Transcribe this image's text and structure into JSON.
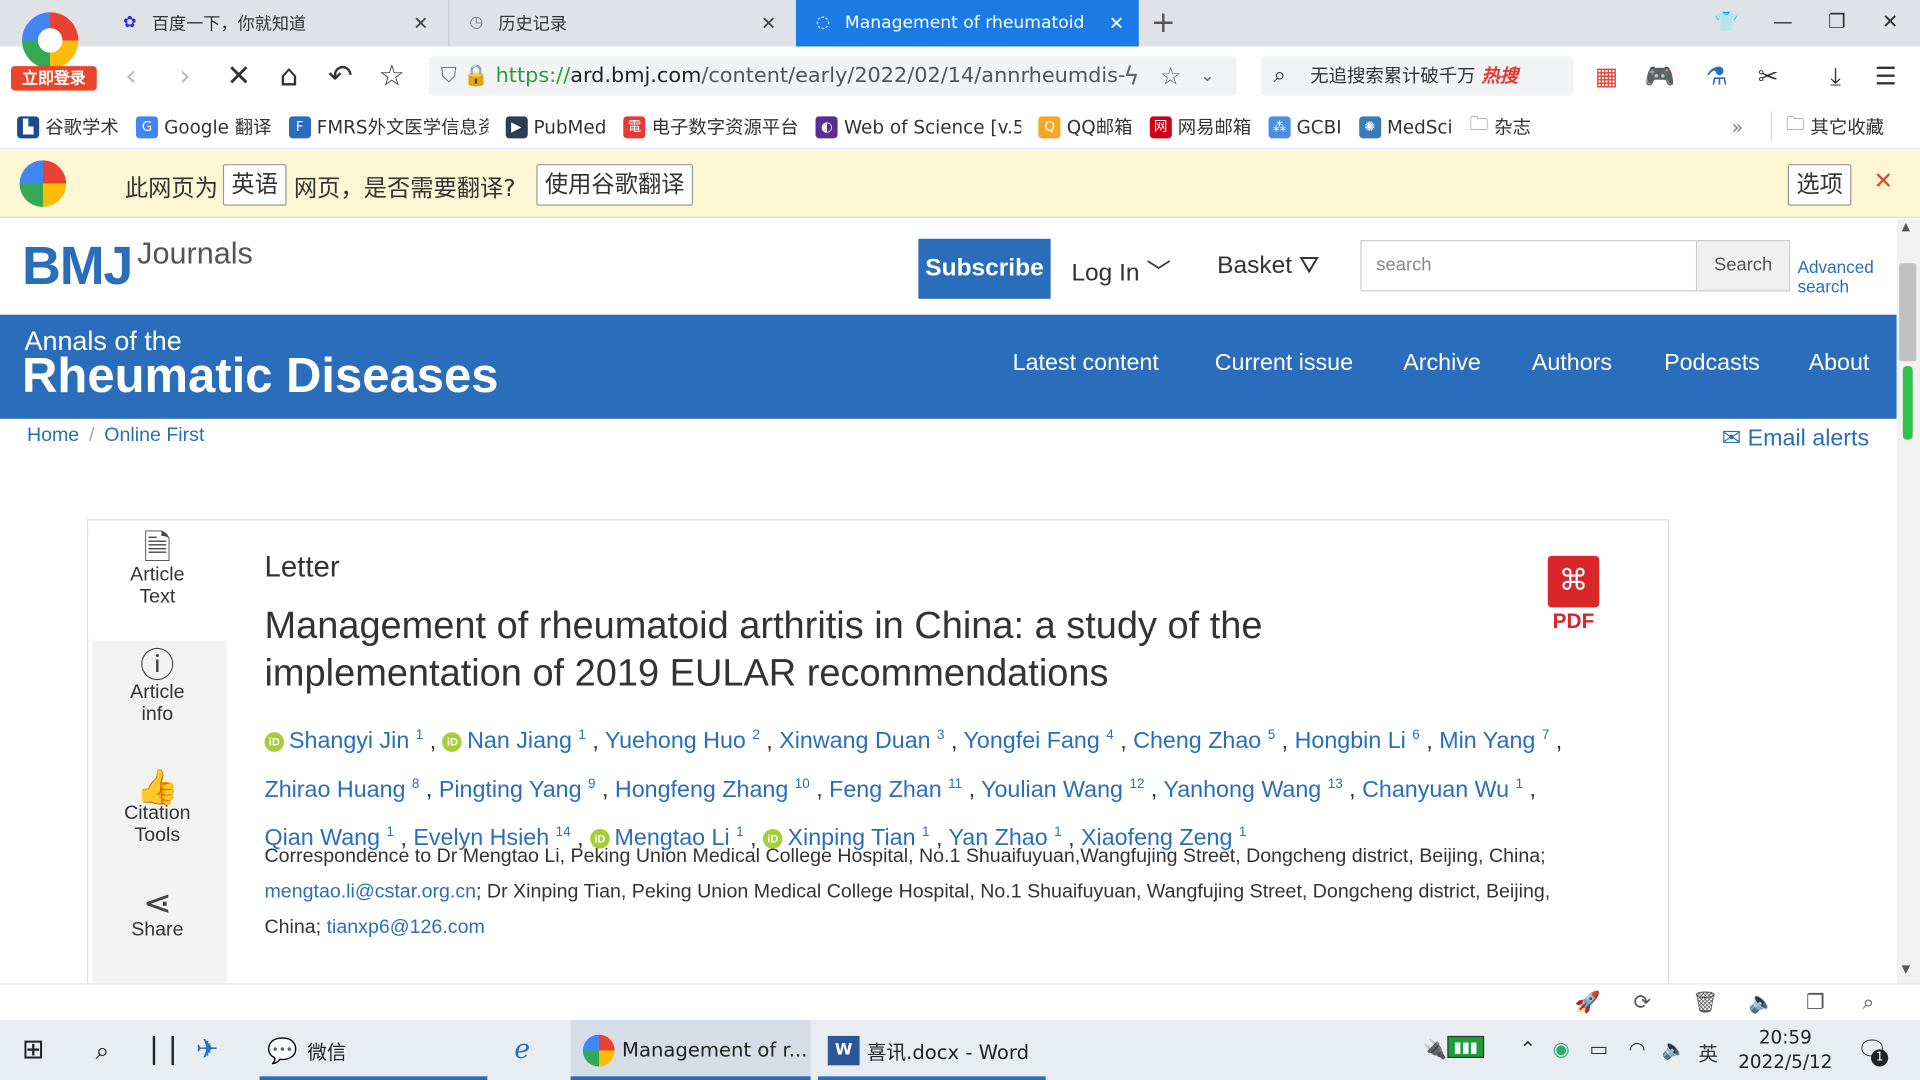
{
  "browser": {
    "login_badge": "立即登录",
    "tabs": [
      {
        "title": "百度一下，你就知道",
        "icon": "baidu-icon"
      },
      {
        "title": "历史记录",
        "icon": "history-icon"
      },
      {
        "title": "Management of rheumatoid",
        "icon": "loading-icon"
      }
    ],
    "url_scheme": "https://",
    "url_host": "ard.bmj.com",
    "url_path": "/content/early/2022/02/14/annrheumdis-",
    "search_hint": "无追搜索累计破千万",
    "search_hot": "热搜",
    "bookmarks": [
      "谷歌学术",
      "Google 翻译",
      "FMRS外文医学信息资",
      "PubMed",
      "电子数字资源平台",
      "Web of Science [v.5",
      "QQ邮箱",
      "网易邮箱",
      "GCBI",
      "MedSci",
      "杂志"
    ],
    "bookmarks_more": "»",
    "bookmarks_other": "其它收藏"
  },
  "translate": {
    "prefix": "此网页为",
    "language": "英语",
    "question": "网页，是否需要翻译?",
    "button": "使用谷歌翻译",
    "options": "选项",
    "close": "✕"
  },
  "site": {
    "logo": "BMJ",
    "journals": "Journals",
    "subscribe": "Subscribe",
    "login": "Log In",
    "basket": "Basket",
    "search_placeholder": "search",
    "search_button": "Search",
    "advanced_1": "Advanced",
    "advanced_2": "search",
    "journal_small": "Annals of the",
    "journal_big": "Rheumatic Diseases",
    "nav": [
      "Latest content",
      "Current issue",
      "Archive",
      "Authors",
      "Podcasts",
      "About"
    ],
    "breadcrumb_home": "Home",
    "breadcrumb_sep": "/",
    "breadcrumb_current": "Online First",
    "email_alerts": "Email alerts"
  },
  "sidebar": [
    {
      "label1": "Article",
      "label2": "Text"
    },
    {
      "label1": "Article",
      "label2": "info"
    },
    {
      "label1": "Citation",
      "label2": "Tools"
    },
    {
      "label1": "Share",
      "label2": ""
    }
  ],
  "article": {
    "type": "Letter",
    "title": "Management of rheumatoid arthritis in China: a study of the implementation of 2019 EULAR recommendations",
    "pdf_label": "PDF",
    "authors": [
      {
        "name": "Shangyi Jin",
        "sup": "1",
        "orcid": true
      },
      {
        "name": "Nan Jiang",
        "sup": "1",
        "orcid": true
      },
      {
        "name": "Yuehong Huo",
        "sup": "2",
        "orcid": false
      },
      {
        "name": "Xinwang Duan",
        "sup": "3",
        "orcid": false
      },
      {
        "name": "Yongfei Fang",
        "sup": "4",
        "orcid": false
      },
      {
        "name": "Cheng Zhao",
        "sup": "5",
        "orcid": false
      },
      {
        "name": "Hongbin Li",
        "sup": "6",
        "orcid": false
      },
      {
        "name": "Min Yang",
        "sup": "7",
        "orcid": false
      },
      {
        "name": "Zhirao Huang",
        "sup": "8",
        "orcid": false
      },
      {
        "name": "Pingting Yang",
        "sup": "9",
        "orcid": false
      },
      {
        "name": "Hongfeng Zhang",
        "sup": "10",
        "orcid": false
      },
      {
        "name": "Feng Zhan",
        "sup": "11",
        "orcid": false
      },
      {
        "name": "Youlian Wang",
        "sup": "12",
        "orcid": false
      },
      {
        "name": "Yanhong Wang",
        "sup": "13",
        "orcid": false
      },
      {
        "name": "Chanyuan Wu",
        "sup": "1",
        "orcid": false
      },
      {
        "name": "Qian Wang",
        "sup": "1",
        "orcid": false
      },
      {
        "name": "Evelyn Hsieh",
        "sup": "14",
        "orcid": false
      },
      {
        "name": "Mengtao Li",
        "sup": "1",
        "orcid": true
      },
      {
        "name": "Xinping Tian",
        "sup": "1",
        "orcid": true
      },
      {
        "name": "Yan Zhao",
        "sup": "1",
        "orcid": false
      },
      {
        "name": "Xiaofeng Zeng",
        "sup": "1",
        "orcid": false
      }
    ],
    "corresp_1": "Correspondence to Dr Mengtao Li, Peking Union Medical College Hospital, No.1 Shuaifuyuan,Wangfujing Street, Dongcheng district, Beijing, China; ",
    "email_1": "mengtao.li@cstar.org.cn",
    "corresp_2": "; Dr Xinping Tian, Peking Union Medical College Hospital, No.1 Shuaifuyuan, Wangfujing Street, Dongcheng district, Beijing, China; ",
    "email_2": "tianxp6@126.com"
  },
  "taskbar": {
    "wechat": "微信",
    "browser_task": "Management of r...",
    "word_task": "喜讯.docx - Word",
    "ime": "英",
    "time": "20:59",
    "date": "2022/5/12",
    "notif_count": "1"
  }
}
